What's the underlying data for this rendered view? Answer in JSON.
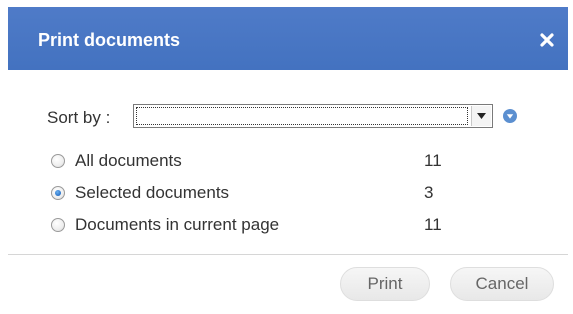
{
  "dialog": {
    "title": "Print documents",
    "close_icon": "close-icon"
  },
  "sort": {
    "label": "Sort by :",
    "selected_value": "",
    "dropdown_icon": "chevron-down-icon",
    "extra_icon": "circle-arrow-down-icon"
  },
  "options": [
    {
      "label": "All documents",
      "count": "11",
      "checked": false
    },
    {
      "label": "Selected documents",
      "count": "3",
      "checked": true
    },
    {
      "label": "Documents in current page",
      "count": "11",
      "checked": false
    }
  ],
  "buttons": {
    "print_label": "Print",
    "cancel_label": "Cancel"
  },
  "colors": {
    "title_bar": "#4a77c4",
    "accent_icon": "#5b8fd0",
    "radio_selected": "#2a72c8"
  }
}
